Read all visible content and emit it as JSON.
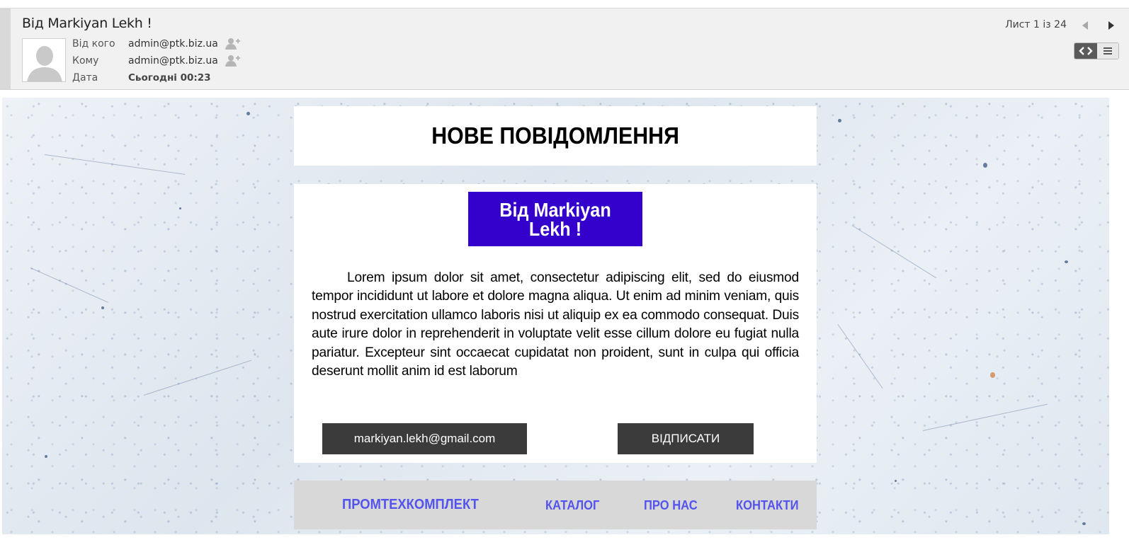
{
  "mail": {
    "subject": "Від Markiyan Lekh !",
    "from_label": "Від кого",
    "from_value": "admin@ptk.biz.ua",
    "to_label": "Кому",
    "to_value": "admin@ptk.biz.ua",
    "date_label": "Дата",
    "date_value": "Сьогодні 00:23",
    "pager": "Лист 1 із 24"
  },
  "newsletter": {
    "title": "НОВЕ ПОВІДОМЛЕННЯ",
    "sender_banner": "Від Markiyan Lekh !",
    "body": "Lorem ipsum dolor sit amet, consectetur adipiscing elit, sed do eiusmod tempor incididunt ut labore et dolore magna aliqua. Ut enim ad minim veniam, quis nostrud exercitation ullamco laboris nisi ut aliquip ex ea commodo consequat. Duis aute irure dolor in reprehenderit in voluptate velit esse cillum dolore eu fugiat nulla pariatur. Excepteur sint occaecat cupidatat non proident, sunt in culpa qui officia deserunt mollit anim id est laborum",
    "email_button": "markiyan.lekh@gmail.com",
    "unsubscribe_button": "ВІДПИСАТИ",
    "footer": {
      "brand": "ПРОМТЕХКОМПЛЕКТ",
      "catalog": "КАТАЛОГ",
      "about": "ПРО НАС",
      "contacts": "КОНТАКТИ"
    }
  },
  "icons": {
    "avatar": "default-avatar-icon",
    "add_contact": "add-contact-icon",
    "prev": "triangle-left-icon",
    "next": "triangle-right-icon",
    "html_view": "code-brackets-icon",
    "text_view": "hamburger-lines-icon"
  },
  "colors": {
    "banner_bg": "#3300cc",
    "button_bg": "#3a3b3a",
    "footer_link": "#5353ee",
    "footer_bg": "#d8d8d8"
  }
}
